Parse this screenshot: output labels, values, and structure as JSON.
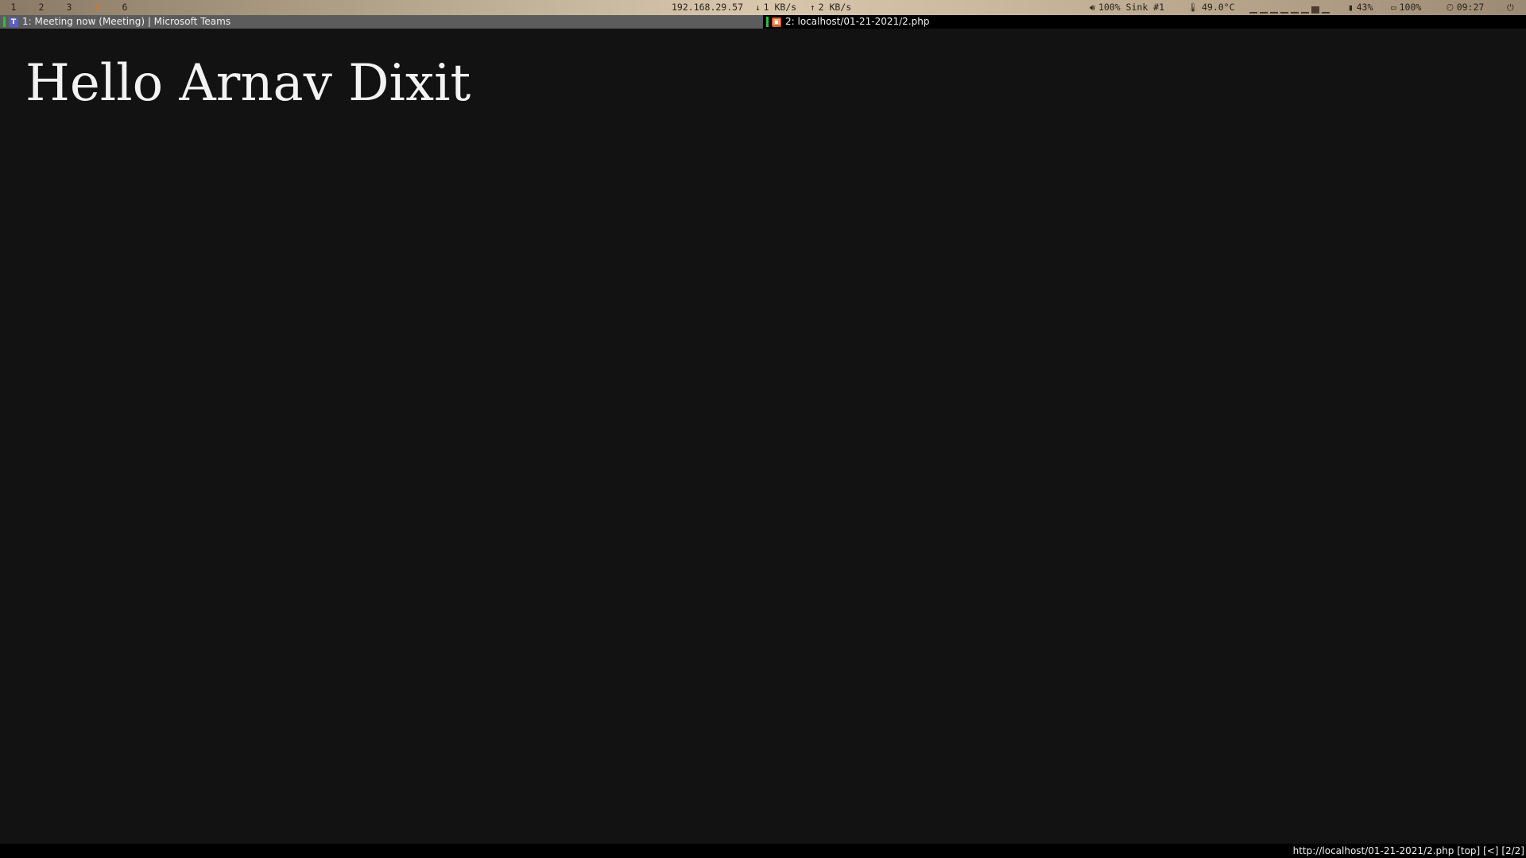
{
  "topbar": {
    "workspaces": [
      {
        "label": "1",
        "focused": false
      },
      {
        "label": "2",
        "focused": false
      },
      {
        "label": "3",
        "focused": false
      },
      {
        "label": "4",
        "focused": true
      },
      {
        "label": "6",
        "focused": false
      }
    ],
    "ip": "192.168.29.57",
    "download": "1 KB/s",
    "upload": "2 KB/s",
    "volume": "100% Sink #1",
    "temperature": "49.0°C",
    "memory": "43%",
    "battery": "100%",
    "clock": "09:27",
    "focused_color": "#e0741c"
  },
  "tabs": [
    {
      "label": "1: Meeting now (Meeting) | Microsoft Teams",
      "icon": "teams-icon",
      "active": false
    },
    {
      "label": "2: localhost/01-21-2021/2.php",
      "icon": "php-icon",
      "active": true
    }
  ],
  "page": {
    "greeting": "Hello Arnav Dixit"
  },
  "statusline": {
    "url": "http://localhost/01-21-2021/2.php",
    "scroll": "[top]",
    "history": "[<]",
    "tab_index": "[2/2]"
  }
}
